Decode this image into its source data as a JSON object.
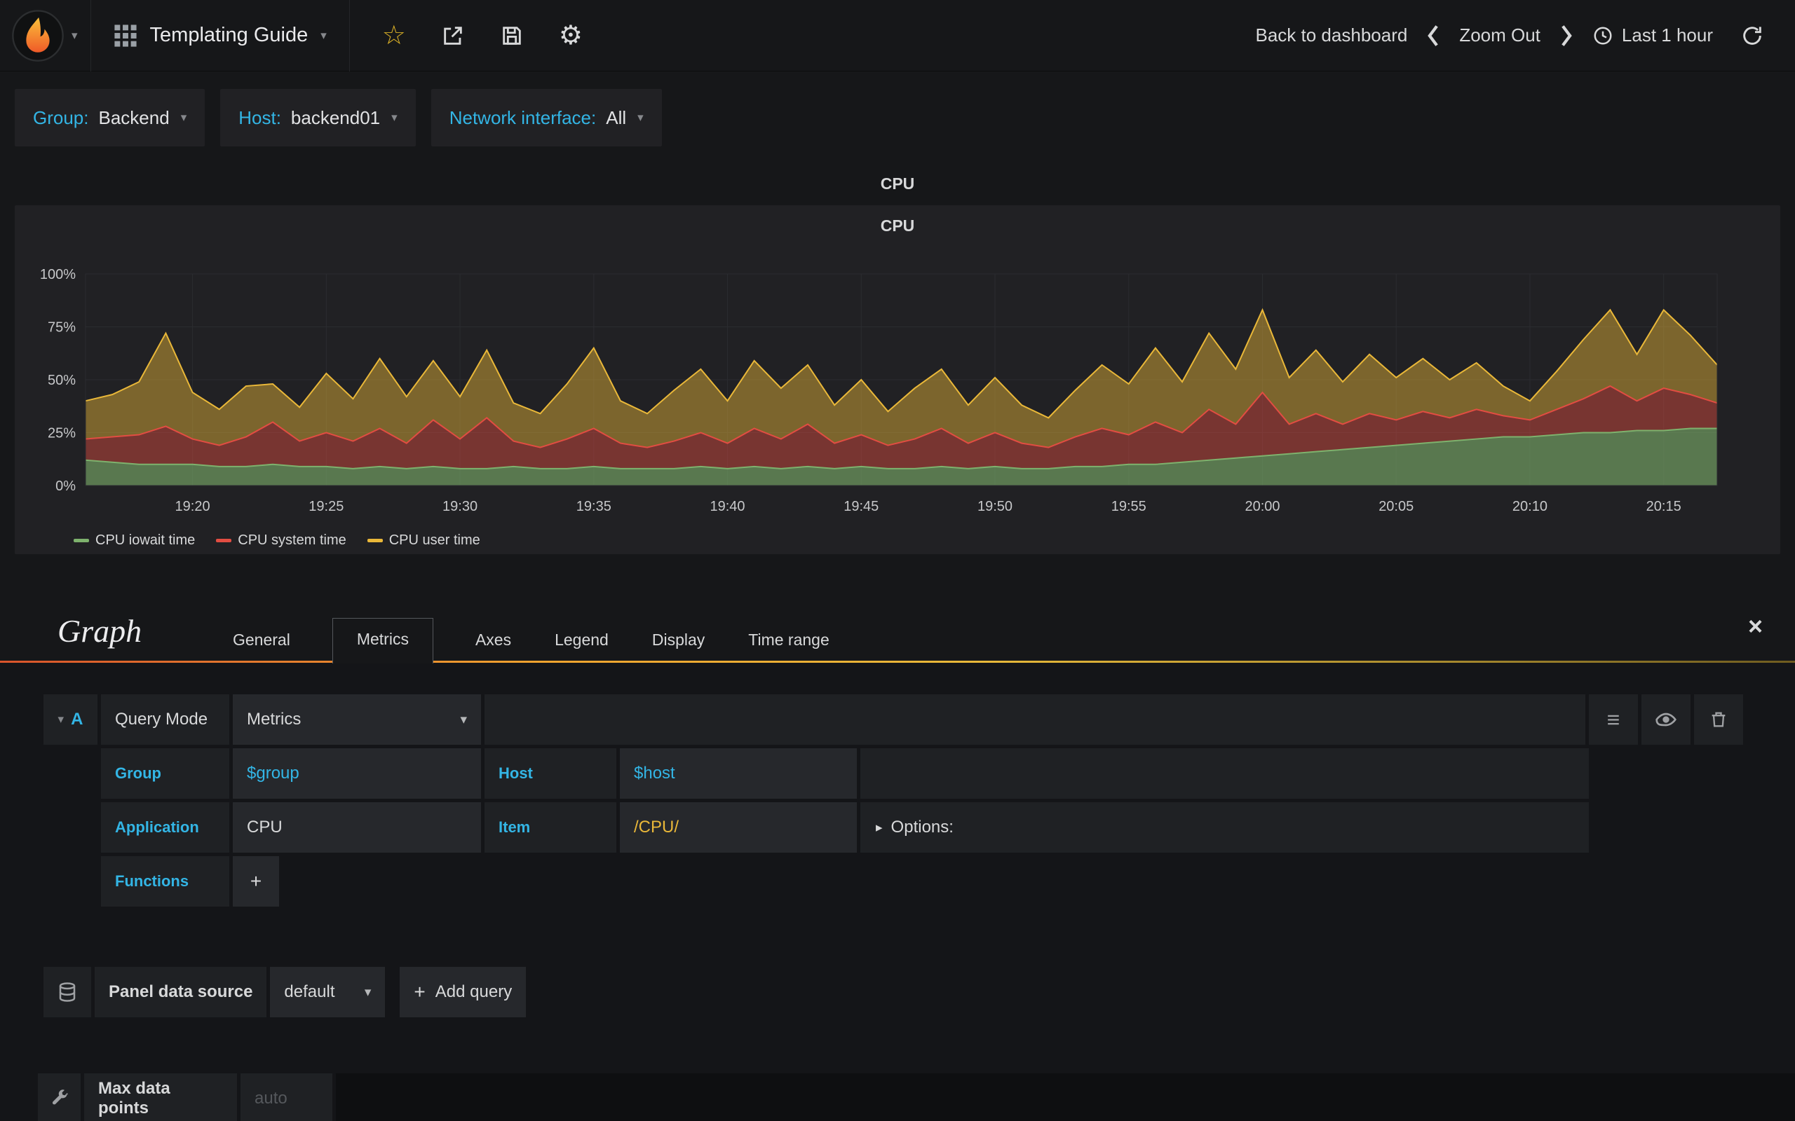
{
  "icons": {
    "caret_down": "▾",
    "caret_right": "▸",
    "close": "×",
    "plus": "+",
    "hamburger": "≡",
    "gear": "⚙",
    "star": "☆"
  },
  "navbar": {
    "title": "Templating Guide",
    "back": "Back to dashboard",
    "zoom_out": "Zoom Out",
    "time_range": "Last 1 hour"
  },
  "variables": [
    {
      "label": "Group:",
      "value": "Backend"
    },
    {
      "label": "Host:",
      "value": "backend01"
    },
    {
      "label": "Network interface:",
      "value": "All"
    }
  ],
  "panel": {
    "title": "CPU"
  },
  "chart_data": {
    "type": "area",
    "stacked": true,
    "title": "CPU",
    "x_start": "19:16",
    "x_end": "20:17",
    "x_step_minutes": 1,
    "x_tick_labels": [
      "19:20",
      "19:25",
      "19:30",
      "19:35",
      "19:40",
      "19:45",
      "19:50",
      "19:55",
      "20:00",
      "20:05",
      "20:10",
      "20:15"
    ],
    "y_tick_labels": [
      "0%",
      "25%",
      "50%",
      "75%",
      "100%"
    ],
    "ylim": [
      0,
      100
    ],
    "grid": true,
    "legend_position": "bottom-left",
    "series": [
      {
        "name": "CPU iowait time",
        "color": "#7EB26D",
        "fill_opacity": 0.6,
        "values": [
          12,
          11,
          10,
          10,
          10,
          9,
          9,
          10,
          9,
          9,
          8,
          9,
          8,
          9,
          8,
          8,
          9,
          8,
          8,
          9,
          8,
          8,
          8,
          9,
          8,
          9,
          8,
          9,
          8,
          9,
          8,
          8,
          9,
          8,
          9,
          8,
          8,
          9,
          9,
          10,
          10,
          11,
          12,
          13,
          14,
          15,
          16,
          17,
          18,
          19,
          20,
          21,
          22,
          23,
          23,
          24,
          25,
          25,
          26,
          26,
          27,
          27
        ]
      },
      {
        "name": "CPU system time",
        "color": "#E24D42",
        "fill_opacity": 0.45,
        "values": [
          10,
          12,
          14,
          18,
          12,
          10,
          14,
          20,
          12,
          16,
          13,
          18,
          12,
          22,
          14,
          24,
          12,
          10,
          14,
          18,
          12,
          10,
          13,
          16,
          12,
          18,
          14,
          20,
          12,
          15,
          11,
          14,
          18,
          12,
          16,
          12,
          10,
          14,
          18,
          14,
          20,
          14,
          24,
          16,
          30,
          14,
          18,
          12,
          16,
          12,
          15,
          11,
          14,
          10,
          8,
          12,
          16,
          22,
          14,
          20,
          16,
          12
        ]
      },
      {
        "name": "CPU user time",
        "color": "#EAB839",
        "fill_opacity": 0.45,
        "values": [
          18,
          20,
          25,
          44,
          22,
          17,
          24,
          18,
          16,
          28,
          20,
          33,
          22,
          28,
          20,
          32,
          18,
          16,
          26,
          38,
          20,
          16,
          24,
          30,
          20,
          32,
          24,
          28,
          18,
          26,
          16,
          24,
          28,
          18,
          26,
          18,
          14,
          22,
          30,
          24,
          35,
          24,
          36,
          26,
          39,
          22,
          30,
          20,
          28,
          20,
          25,
          18,
          22,
          14,
          9,
          18,
          28,
          36,
          22,
          37,
          28,
          18
        ]
      }
    ]
  },
  "editor": {
    "panel_type": "Graph",
    "tabs": [
      "General",
      "Metrics",
      "Axes",
      "Legend",
      "Display",
      "Time range"
    ],
    "active_tab": "Metrics",
    "query": {
      "ref": "A",
      "mode_label": "Query Mode",
      "mode_value": "Metrics",
      "group_label": "Group",
      "group_value": "$group",
      "host_label": "Host",
      "host_value": "$host",
      "application_label": "Application",
      "application_value": "CPU",
      "item_label": "Item",
      "item_value": "/CPU/",
      "options_label": "Options:",
      "functions_label": "Functions"
    },
    "datasource": {
      "label": "Panel data source",
      "value": "default",
      "add_query": "Add query"
    },
    "max_data_points": {
      "label": "Max data points",
      "placeholder": "auto"
    }
  }
}
